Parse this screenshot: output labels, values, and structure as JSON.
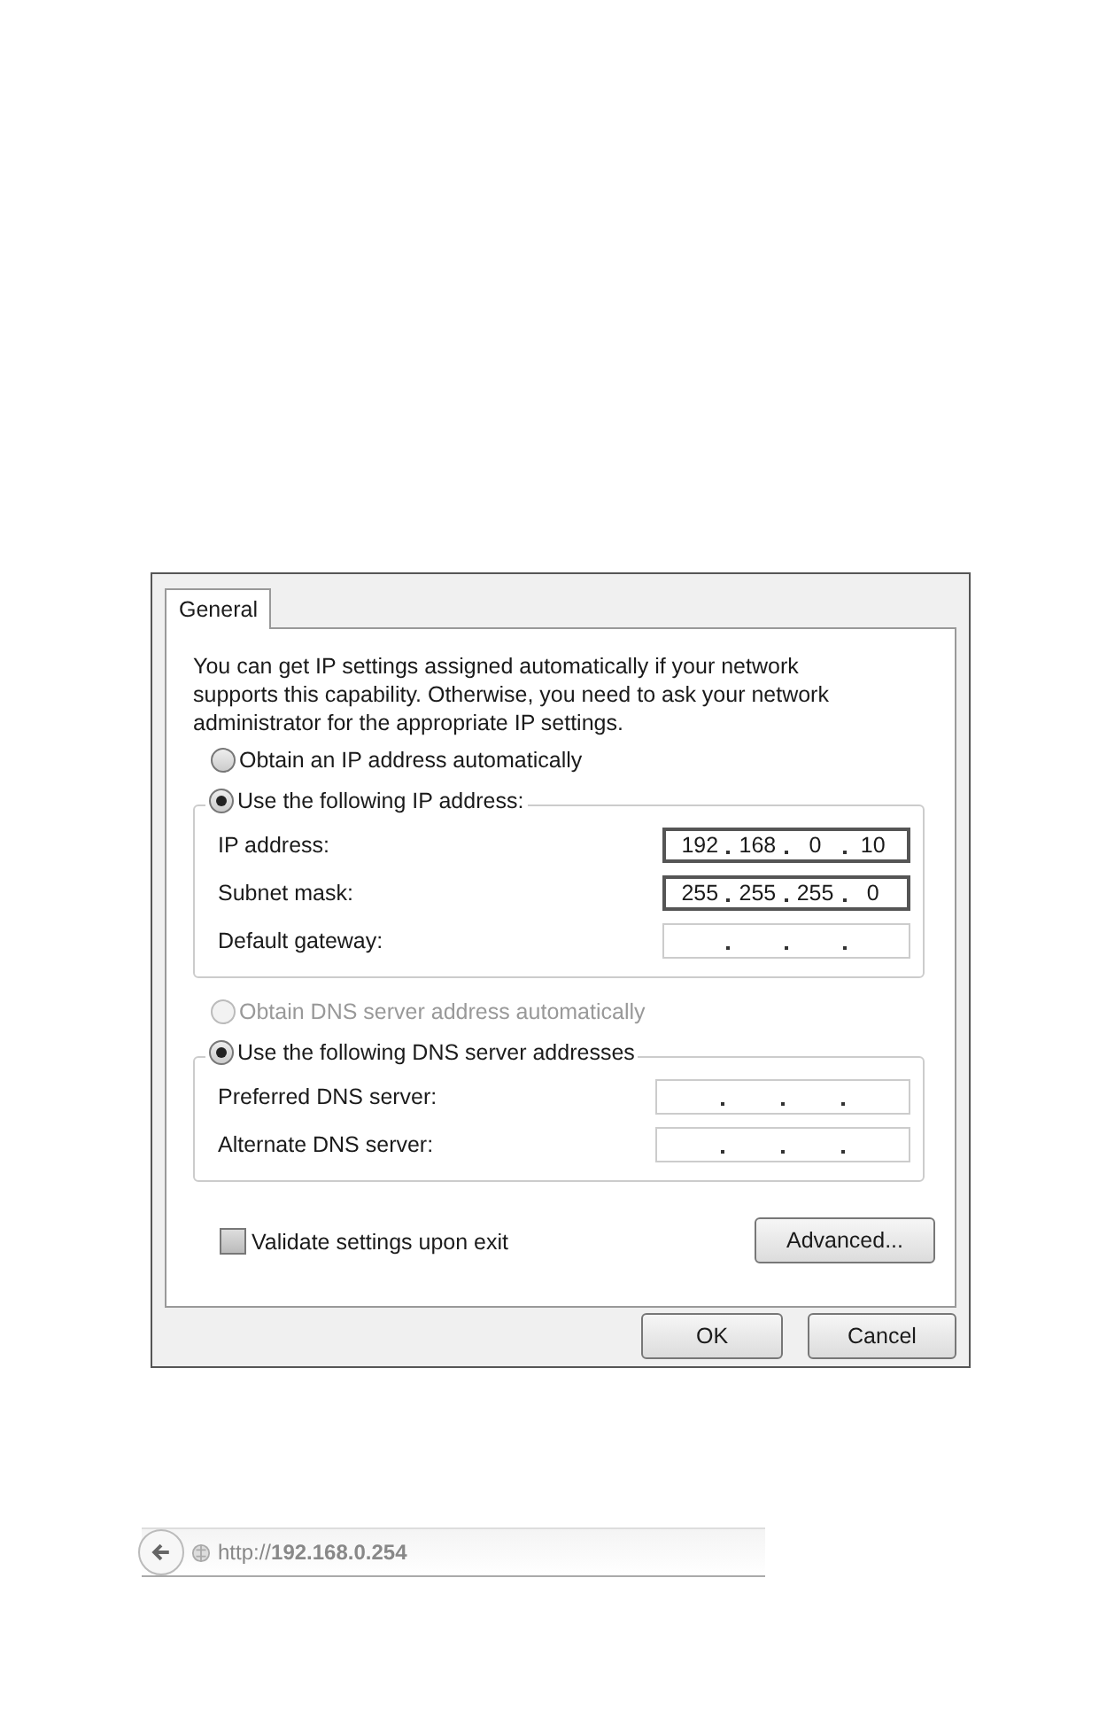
{
  "dialog": {
    "tabs": [
      {
        "label": "General",
        "selected": true
      }
    ],
    "description": "You can get IP settings assigned automatically if your network supports this capability. Otherwise, you need to ask your network administrator for the appropriate IP settings.",
    "ip_auto_option": {
      "label": "Obtain an IP address automatically",
      "selected": false,
      "disabled": false
    },
    "ip_manual_option": {
      "label": "Use the following IP address:",
      "selected": true,
      "disabled": false
    },
    "ip_fields": [
      {
        "label": "IP address:",
        "octets": [
          "192",
          "168",
          "0",
          "10"
        ]
      },
      {
        "label": "Subnet mask:",
        "octets": [
          "255",
          "255",
          "255",
          "0"
        ]
      },
      {
        "label": "Default gateway:"
      }
    ],
    "dns_auto_option": {
      "label": "Obtain DNS server address automatically",
      "selected": false,
      "disabled": true
    },
    "dns_manual_option": {
      "label": "Use the following DNS server addresses",
      "selected": true,
      "disabled": false
    },
    "dns_fields": [
      {
        "label": "Preferred DNS server:"
      },
      {
        "label": "Alternate DNS server:"
      }
    ],
    "validate_checkbox": {
      "label": "Validate settings upon exit",
      "checked": false
    },
    "advanced_button": "Advanced...",
    "buttons": [
      "OK",
      "Cancel"
    ]
  },
  "browser_bar": {
    "url": "http://**192.168.0.254**"
  }
}
